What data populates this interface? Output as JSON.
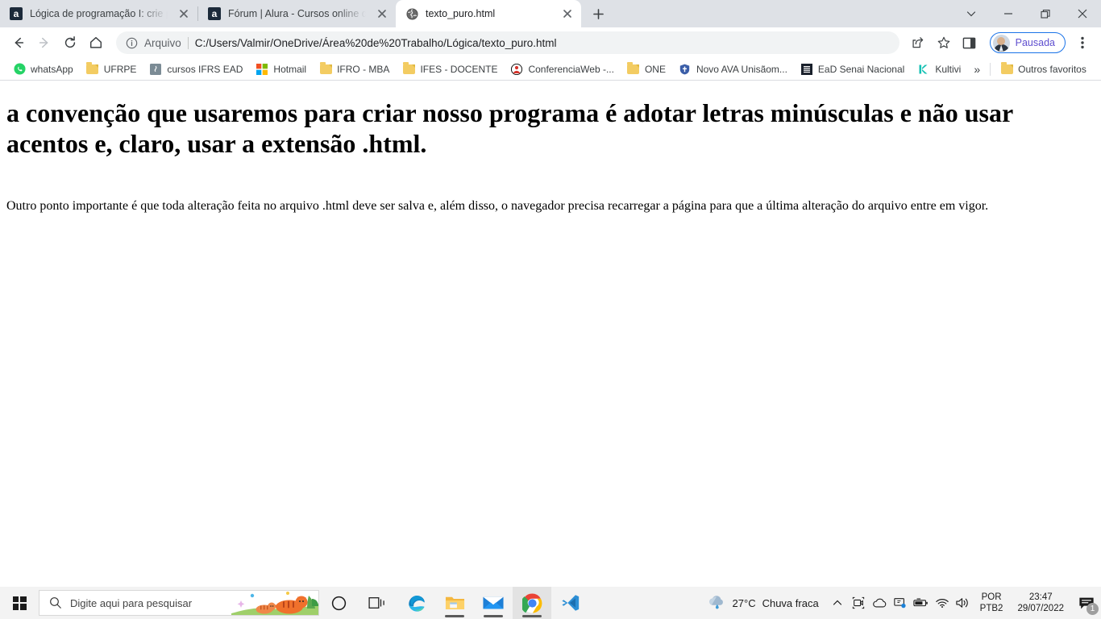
{
  "window": {
    "controls": {
      "tab_search": "tab-search-chevron",
      "minimize": "minimize",
      "maximize": "restore",
      "close": "close"
    }
  },
  "tabs": [
    {
      "title": "Lógica de programação I: crie pro",
      "favicon": "alura-a-icon",
      "active": false
    },
    {
      "title": "Fórum | Alura - Cursos online de",
      "favicon": "alura-a-icon",
      "active": false
    },
    {
      "title": "texto_puro.html",
      "favicon": "globe-icon",
      "active": true
    }
  ],
  "newtab_label": "+",
  "toolbar": {
    "back": "back-arrow",
    "forward": "forward-arrow",
    "reload": "reload",
    "home": "home",
    "omnibox": {
      "info_icon": "info-circle-icon",
      "scheme_label": "Arquivo",
      "url": "C:/Users/Valmir/OneDrive/Área%20de%20Trabalho/Lógica/texto_puro.html"
    },
    "share": "share-icon",
    "bookmark_star": "star-icon",
    "side_panel": "side-panel-icon",
    "profile_label": "Pausada",
    "menu": "three-dot-menu"
  },
  "bookmarks": {
    "items": [
      {
        "label": "whatsApp",
        "icon": "whatsapp-icon"
      },
      {
        "label": "UFRPE",
        "icon": "folder-icon"
      },
      {
        "label": "cursos IFRS EAD",
        "icon": "site-icon"
      },
      {
        "label": "Hotmail",
        "icon": "microsoft-icon"
      },
      {
        "label": "IFRO - MBA",
        "icon": "folder-icon"
      },
      {
        "label": "IFES - DOCENTE",
        "icon": "folder-icon"
      },
      {
        "label": "ConferenciaWeb -...",
        "icon": "conferenciaweb-icon"
      },
      {
        "label": "ONE",
        "icon": "folder-icon"
      },
      {
        "label": "Novo AVA Unisãom...",
        "icon": "shield-icon"
      },
      {
        "label": "EaD Senai Nacional",
        "icon": "senai-icon"
      },
      {
        "label": "Kultivi",
        "icon": "kultivi-icon"
      }
    ],
    "overflow_label": "»",
    "other_label": "Outros favoritos",
    "other_icon": "folder-icon"
  },
  "page": {
    "heading": "a convenção que usaremos para criar nosso programa é adotar letras minúsculas e não usar acentos e, claro, usar a extensão .html.",
    "paragraph": "Outro ponto importante é que toda alteração feita no arquivo .html deve ser salva e, além disso, o navegador precisa recarregar a página para que a última alteração do arquivo entre em vigor."
  },
  "taskbar": {
    "start_icon": "windows-start-icon",
    "search_placeholder": "Digite aqui para pesquisar",
    "search_icon": "magnifier-icon",
    "cortana_icon": "cortana-circle-icon",
    "taskview_icon": "task-view-icon",
    "apps": [
      {
        "name": "microsoft-edge-icon",
        "running": false,
        "active": false
      },
      {
        "name": "file-explorer-icon",
        "running": true,
        "active": false
      },
      {
        "name": "mail-icon",
        "running": true,
        "active": false
      },
      {
        "name": "google-chrome-icon",
        "running": true,
        "active": true
      },
      {
        "name": "vscode-icon",
        "running": false,
        "active": false
      }
    ],
    "weather": {
      "icon": "rain-cloud-icon",
      "temperature": "27°C",
      "condition": "Chuva fraca"
    },
    "tray": {
      "overflow_icon": "chevron-up-icon",
      "icons": [
        "camera-icon",
        "onedrive-cloud-icon",
        "remote-desktop-icon",
        "battery-icon",
        "wifi-icon",
        "volume-icon"
      ],
      "language_line1": "POR",
      "language_line2": "PTB2",
      "time": "23:47",
      "date": "29/07/2022",
      "notification_icon": "notification-icon",
      "notification_count": "1"
    }
  },
  "colors": {
    "tabstrip_bg": "#dee1e6",
    "toolbar_bg": "#ffffff",
    "omnibox_bg": "#f1f3f4",
    "accent_blue": "#1a73e8",
    "profile_text": "#5f4fcf",
    "taskbar_bg": "#f3f3f3"
  }
}
